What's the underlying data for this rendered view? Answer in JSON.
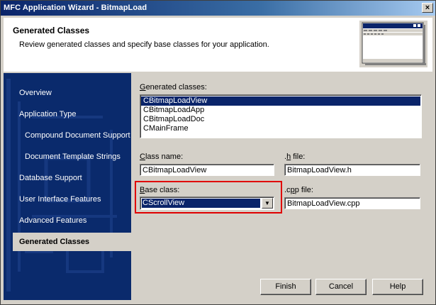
{
  "window": {
    "title": "MFC Application Wizard - BitmapLoad"
  },
  "header": {
    "title": "Generated Classes",
    "subtitle": "Review generated classes and specify base classes for your application."
  },
  "nav": {
    "items": [
      {
        "label": "Overview"
      },
      {
        "label": "Application Type"
      },
      {
        "label": "Compound Document Support"
      },
      {
        "label": "Document Template Strings"
      },
      {
        "label": "Database Support"
      },
      {
        "label": "User Interface Features"
      },
      {
        "label": "Advanced Features"
      },
      {
        "label": "Generated Classes"
      }
    ]
  },
  "form": {
    "generated_label_first": "G",
    "generated_label_rest": "enerated classes:",
    "generated_classes": [
      "CBitmapLoadView",
      "CBitmapLoadApp",
      "CBitmapLoadDoc",
      "CMainFrame"
    ],
    "class_name_label_first": "C",
    "class_name_label_rest": "lass name:",
    "class_name_value": "CBitmapLoadView",
    "h_file_label_pre": ".",
    "h_file_label_u": "h",
    "h_file_label_rest": " file:",
    "h_file_value": "BitmapLoadView.h",
    "base_class_label_first": "B",
    "base_class_label_rest": "ase class:",
    "base_class_value": "CScrollView",
    "cpp_file_label_pre": ".c",
    "cpp_file_label_u": "p",
    "cpp_file_label_rest": "p file:",
    "cpp_file_value": "BitmapLoadView.cpp"
  },
  "buttons": {
    "finish": "Finish",
    "cancel": "Cancel",
    "help": "Help"
  },
  "colors": {
    "title_bar": "#0a246a",
    "nav_background": "#0a2a6c",
    "selection": "#0a246a",
    "highlight_box": "#e00000"
  }
}
